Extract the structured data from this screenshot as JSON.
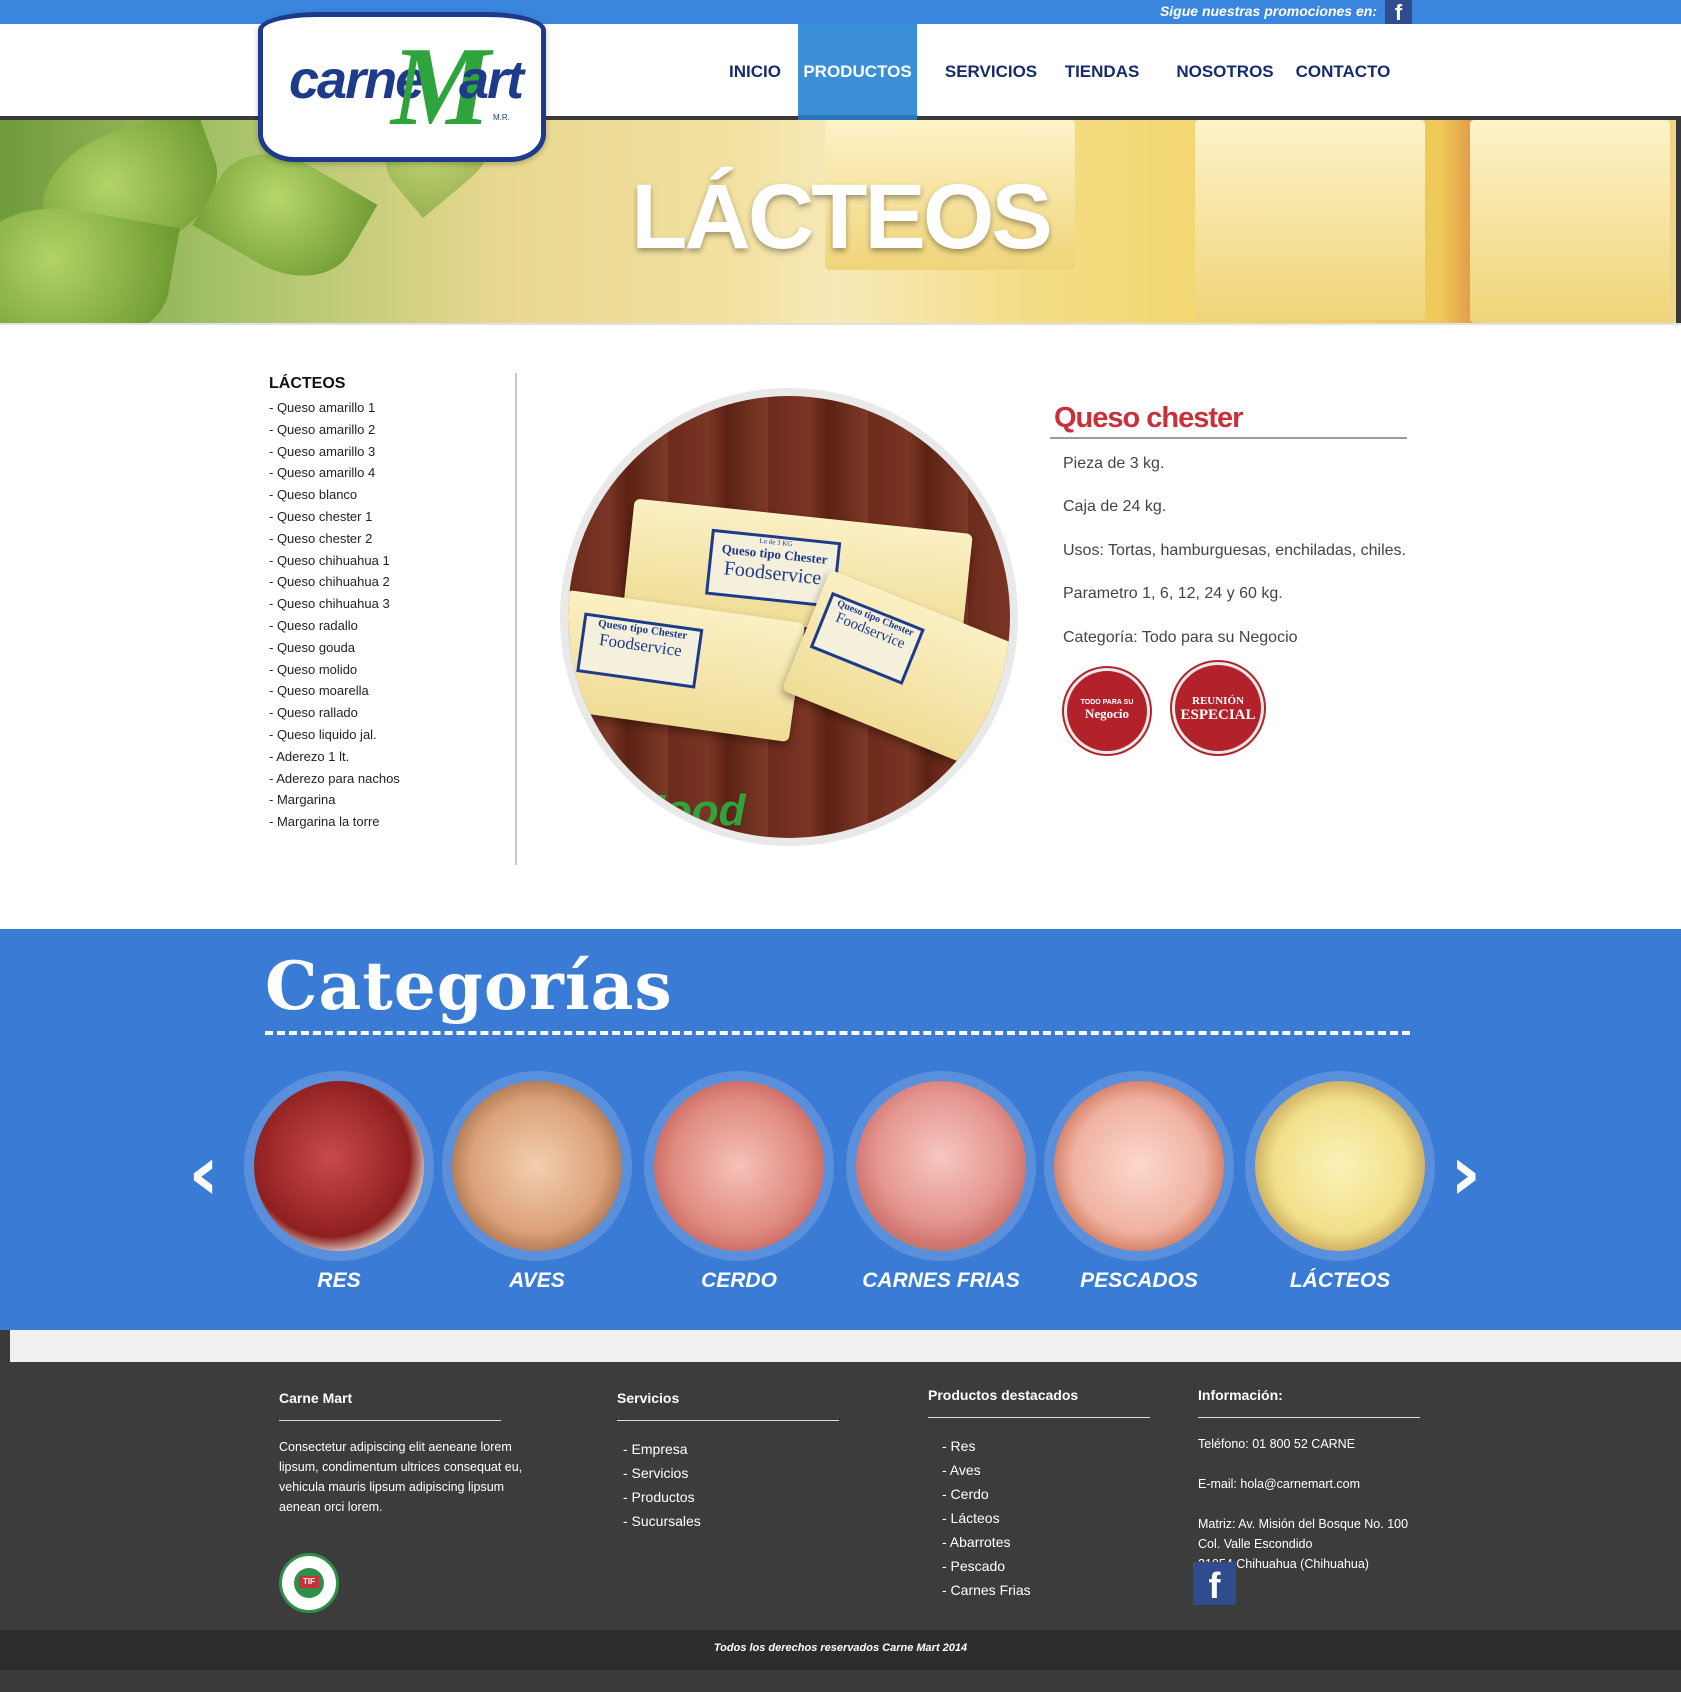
{
  "topbar": {
    "promo_text": "Sigue nuestras promociones en:",
    "fb_icon": "f"
  },
  "logo": {
    "carne": "carne",
    "m": "M",
    "art": "art",
    "mr": "M.R."
  },
  "nav": [
    {
      "label": "INICIO",
      "active": false
    },
    {
      "label": "PRODUCTOS",
      "active": true
    },
    {
      "label": "SERVICIOS",
      "active": false
    },
    {
      "label": "TIENDAS",
      "active": false
    },
    {
      "label": "NOSOTROS",
      "active": false
    },
    {
      "label": "CONTACTO",
      "active": false
    }
  ],
  "banner": {
    "title": "LÁCTEOS"
  },
  "sidebar": {
    "title": "LÁCTEOS",
    "items": [
      "- Queso amarillo 1",
      "- Queso amarillo 2",
      "- Queso amarillo 3",
      "- Queso amarillo 4",
      "- Queso blanco",
      "- Queso chester 1",
      "- Queso chester 2",
      "- Queso chihuahua 1",
      "- Queso chihuahua 2",
      "- Queso chihuahua 3",
      "- Queso radallo",
      "- Queso gouda",
      "- Queso molido",
      "- Queso moarella",
      "- Queso rallado",
      "- Queso liquido jal.",
      "- Aderezo 1 lt.",
      "- Aderezo para nachos",
      "- Margarina",
      "- Margarina la torre"
    ]
  },
  "product": {
    "image_labels": {
      "small": "Lo de 3 KG",
      "name": "Queso tipo Chester",
      "brand": "Foodservice",
      "fs_logo": "Food"
    },
    "title": "Queso chester",
    "details": [
      "Pieza de 3 kg.",
      "Caja de 24 kg.",
      "Usos: Tortas, hamburguesas, enchiladas, chiles.",
      "Parametro 1, 6, 12, 24 y 60 kg.",
      "Categoría: Todo para su Negocio"
    ],
    "badges": [
      {
        "top": "TODO PARA SU",
        "label": "Negocio"
      },
      {
        "top": "REUNIÓN",
        "label": "ESPECIAL"
      }
    ]
  },
  "categories": {
    "title": "Categorías",
    "prev": "‹",
    "next": "›",
    "items": [
      {
        "label": "RES",
        "color": "#b23a3a"
      },
      {
        "label": "AVES",
        "color": "#e7b48c"
      },
      {
        "label": "CERDO",
        "color": "#e38e86"
      },
      {
        "label": "CARNES FRIAS",
        "color": "#e79b98"
      },
      {
        "label": "PESCADOS",
        "color": "#f0b2a2"
      },
      {
        "label": "LÁCTEOS",
        "color": "#f1e08a"
      }
    ]
  },
  "footer": {
    "col1": {
      "title": "Carne Mart",
      "text": "Consectetur adipiscing elit aeneane lorem lipsum, condimentum ultrices consequat eu, vehicula mauris lipsum adipiscing lipsum aenean orci lorem.",
      "tif": "TIF"
    },
    "col2": {
      "title": "Servicios",
      "items": [
        "- Empresa",
        "- Servicios",
        "- Productos",
        "- Sucursales"
      ]
    },
    "col3": {
      "title": "Productos destacados",
      "items": [
        "- Res",
        "- Aves",
        "- Cerdo",
        "- Lácteos",
        "- Abarrotes",
        "- Pescado",
        "- Carnes Frias"
      ]
    },
    "col4": {
      "title": "Información:",
      "phone": "Teléfono: 01 800 52 CARNE",
      "email": "E-mail: hola@carnemart.com",
      "address1": "Matriz: Av. Misión del Bosque No. 100",
      "address2": "Col. Valle Escondido",
      "address3": "31054 Chihuahua (Chihuahua)",
      "fb_icon": "f"
    },
    "copyright": "Todos los derechos reservados Carne Mart 2014"
  }
}
